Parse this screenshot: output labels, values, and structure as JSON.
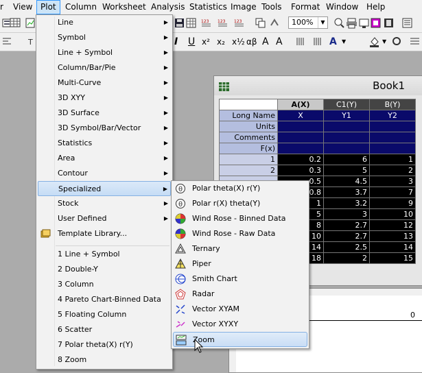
{
  "menubar": {
    "items": [
      {
        "label": "r"
      },
      {
        "label": "View"
      },
      {
        "label": "Plot"
      },
      {
        "label": "Column"
      },
      {
        "label": "Worksheet"
      },
      {
        "label": "Analysis"
      },
      {
        "label": "Statistics"
      },
      {
        "label": "Image"
      },
      {
        "label": "Tools"
      },
      {
        "label": "Format"
      },
      {
        "label": "Window"
      },
      {
        "label": "Help"
      }
    ]
  },
  "toolbar": {
    "zoom_value": "100%"
  },
  "plot_menu": {
    "items": [
      {
        "label": "Line"
      },
      {
        "label": "Symbol"
      },
      {
        "label": "Line + Symbol"
      },
      {
        "label": "Column/Bar/Pie"
      },
      {
        "label": "Multi-Curve"
      },
      {
        "label": "3D XYY"
      },
      {
        "label": "3D Surface"
      },
      {
        "label": "3D Symbol/Bar/Vector"
      },
      {
        "label": "Statistics"
      },
      {
        "label": "Area"
      },
      {
        "label": "Contour"
      },
      {
        "label": "Specialized"
      },
      {
        "label": "Stock"
      },
      {
        "label": "User Defined"
      },
      {
        "label": "Template Library..."
      }
    ],
    "recent": [
      {
        "label": "1 Line + Symbol"
      },
      {
        "label": "2 Double-Y"
      },
      {
        "label": "3 Column"
      },
      {
        "label": "4 Pareto Chart-Binned Data"
      },
      {
        "label": "5 Floating Column"
      },
      {
        "label": "6 Scatter"
      },
      {
        "label": "7 Polar theta(X) r(Y)"
      },
      {
        "label": "8 Zoom"
      }
    ]
  },
  "specialized_menu": {
    "items": [
      {
        "label": "Polar theta(X) r(Y)"
      },
      {
        "label": "Polar r(X) theta(Y)"
      },
      {
        "label": "Wind Rose - Binned Data"
      },
      {
        "label": "Wind Rose - Raw Data"
      },
      {
        "label": "Ternary"
      },
      {
        "label": "Piper"
      },
      {
        "label": "Smith Chart"
      },
      {
        "label": "Radar"
      },
      {
        "label": "Vector XYAM"
      },
      {
        "label": "Vector XYXY"
      },
      {
        "label": "Zoom"
      }
    ]
  },
  "book": {
    "title": "Book1",
    "columns": [
      "A(X)",
      "C1(Y)",
      "B(Y)"
    ],
    "row_labels": [
      "Long Name",
      "Units",
      "Comments",
      "F(x)"
    ],
    "long_names": [
      "X",
      "Y1",
      "Y2"
    ],
    "rows": [
      {
        "n": "1",
        "a": "0.2",
        "c": "6",
        "b": "1"
      },
      {
        "n": "2",
        "a": "0.3",
        "c": "5",
        "b": "2"
      },
      {
        "n": "",
        "a": "0.5",
        "c": "4.5",
        "b": "3"
      },
      {
        "n": "",
        "a": "0.8",
        "c": "3.7",
        "b": "7"
      },
      {
        "n": "",
        "a": "1",
        "c": "3.2",
        "b": "9"
      },
      {
        "n": "",
        "a": "5",
        "c": "3",
        "b": "10"
      },
      {
        "n": "",
        "a": "8",
        "c": "2.7",
        "b": "12"
      },
      {
        "n": "",
        "a": "10",
        "c": "2.7",
        "b": "13"
      },
      {
        "n": "",
        "a": "14",
        "c": "2.5",
        "b": "14"
      },
      {
        "n": "",
        "a": "18",
        "c": "2",
        "b": "15"
      }
    ]
  },
  "graph": {
    "tick_label": "0"
  }
}
